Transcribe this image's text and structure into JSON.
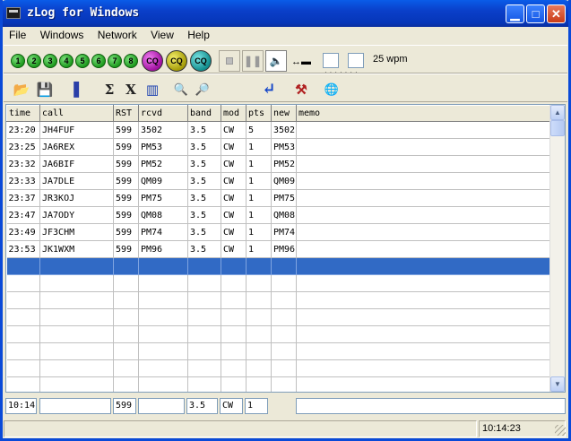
{
  "window": {
    "title": "zLog for Windows"
  },
  "menu": [
    {
      "label": "File"
    },
    {
      "label": "Windows"
    },
    {
      "label": "Network"
    },
    {
      "label": "View"
    },
    {
      "label": "Help"
    }
  ],
  "toolbar1": {
    "memory_buttons": [
      "1",
      "2",
      "3",
      "4",
      "5",
      "6",
      "7",
      "8"
    ],
    "cq_buttons": [
      "CQ",
      "CQ",
      "CQ"
    ],
    "wpm_value": "25",
    "wpm_label": "25 wpm"
  },
  "toolbar2": {
    "buttons": [
      {
        "name": "open-icon",
        "glyph": "📂"
      },
      {
        "name": "save-icon",
        "glyph": "💾"
      },
      {
        "name": "bandscope-icon",
        "glyph": "▌"
      },
      {
        "name": "sum-icon",
        "glyph": "Σ"
      },
      {
        "name": "multiplier-icon",
        "glyph": "X"
      },
      {
        "name": "graph-icon",
        "glyph": "▥"
      },
      {
        "name": "zoom-in-icon",
        "glyph": "🔍"
      },
      {
        "name": "zoom-out-icon",
        "glyph": "🔎"
      },
      {
        "name": "enter-icon",
        "glyph": "↵"
      },
      {
        "name": "tools-icon",
        "glyph": "⚒"
      },
      {
        "name": "globe-icon",
        "glyph": "🌐"
      }
    ]
  },
  "grid": {
    "columns": [
      "time",
      "call",
      "RST",
      "rcvd",
      "band",
      "mod",
      "pts",
      "new",
      "memo"
    ],
    "rows": [
      [
        "23:20",
        "JH4FUF",
        "599",
        "3502",
        "3.5",
        "CW",
        "5",
        "3502",
        ""
      ],
      [
        "23:25",
        "JA6REX",
        "599",
        "PM53",
        "3.5",
        "CW",
        "1",
        "PM53",
        ""
      ],
      [
        "23:32",
        "JA6BIF",
        "599",
        "PM52",
        "3.5",
        "CW",
        "1",
        "PM52",
        ""
      ],
      [
        "23:33",
        "JA7DLE",
        "599",
        "QM09",
        "3.5",
        "CW",
        "1",
        "QM09",
        ""
      ],
      [
        "23:37",
        "JR3KOJ",
        "599",
        "PM75",
        "3.5",
        "CW",
        "1",
        "PM75",
        ""
      ],
      [
        "23:47",
        "JA7ODY",
        "599",
        "QM08",
        "3.5",
        "CW",
        "1",
        "QM08",
        ""
      ],
      [
        "23:49",
        "JF3CHM",
        "599",
        "PM74",
        "3.5",
        "CW",
        "1",
        "PM74",
        ""
      ],
      [
        "23:53",
        "JK1WXM",
        "599",
        "PM96",
        "3.5",
        "CW",
        "1",
        "PM96",
        ""
      ]
    ],
    "selected_row_index": 8,
    "total_rows": 17
  },
  "entry": {
    "time": "10:14",
    "call": "",
    "rst": "599",
    "rcvd": "",
    "band": "3.5",
    "mode": "CW",
    "pts": "1",
    "memo": ""
  },
  "status": {
    "clock": "10:14:23"
  },
  "colors": {
    "title_bar": "#0a3fc9",
    "selection": "#316ac5",
    "window_bg": "#ece9d8"
  }
}
